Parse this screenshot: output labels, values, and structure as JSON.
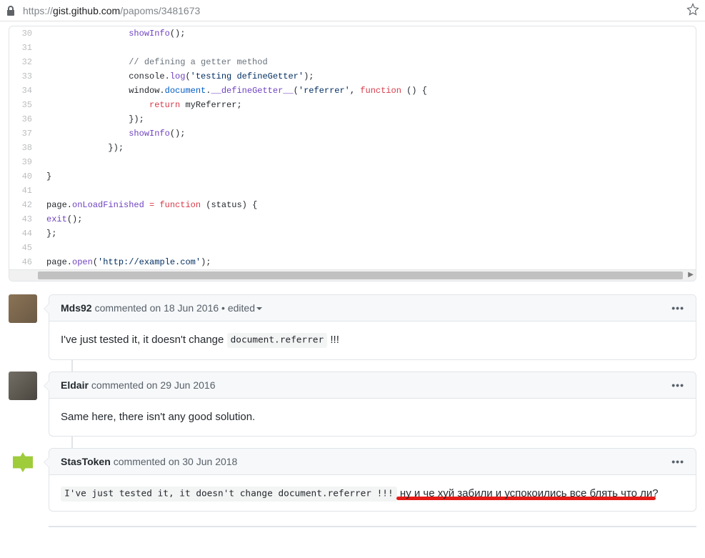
{
  "urlbar": {
    "scheme": "https://",
    "host": "gist.github.com",
    "path": "/papoms/3481673"
  },
  "code": {
    "lines": [
      {
        "n": 30,
        "ind": 16,
        "tokens": [
          {
            "t": "showInfo",
            "c": "pl-en"
          },
          {
            "t": "();"
          }
        ]
      },
      {
        "n": 31,
        "ind": 0,
        "tokens": []
      },
      {
        "n": 32,
        "ind": 16,
        "tokens": [
          {
            "t": "// defining a getter method",
            "c": "pl-c"
          }
        ]
      },
      {
        "n": 33,
        "ind": 16,
        "tokens": [
          {
            "t": "console"
          },
          {
            "t": "."
          },
          {
            "t": "log",
            "c": "pl-en"
          },
          {
            "t": "("
          },
          {
            "t": "'testing defineGetter'",
            "c": "pl-s"
          },
          {
            "t": ");"
          }
        ]
      },
      {
        "n": 34,
        "ind": 16,
        "tokens": [
          {
            "t": "window"
          },
          {
            "t": "."
          },
          {
            "t": "document",
            "c": "pl-smi"
          },
          {
            "t": "."
          },
          {
            "t": "__defineGetter__",
            "c": "pl-en"
          },
          {
            "t": "("
          },
          {
            "t": "'referrer'",
            "c": "pl-s"
          },
          {
            "t": ", "
          },
          {
            "t": "function",
            "c": "pl-k"
          },
          {
            "t": " () {"
          }
        ]
      },
      {
        "n": 35,
        "ind": 20,
        "tokens": [
          {
            "t": "return",
            "c": "pl-k"
          },
          {
            "t": " myReferrer;"
          }
        ]
      },
      {
        "n": 36,
        "ind": 16,
        "tokens": [
          {
            "t": "});"
          }
        ]
      },
      {
        "n": 37,
        "ind": 16,
        "tokens": [
          {
            "t": "showInfo",
            "c": "pl-en"
          },
          {
            "t": "();"
          }
        ]
      },
      {
        "n": 38,
        "ind": 12,
        "tokens": [
          {
            "t": "});"
          }
        ]
      },
      {
        "n": 39,
        "ind": 0,
        "tokens": []
      },
      {
        "n": 40,
        "ind": 0,
        "tokens": [
          {
            "t": "}"
          }
        ]
      },
      {
        "n": 41,
        "ind": 0,
        "tokens": []
      },
      {
        "n": 42,
        "ind": 0,
        "tokens": [
          {
            "t": "page"
          },
          {
            "t": "."
          },
          {
            "t": "onLoadFinished",
            "c": "pl-en"
          },
          {
            "t": " "
          },
          {
            "t": "=",
            "c": "pl-k"
          },
          {
            "t": " "
          },
          {
            "t": "function",
            "c": "pl-k"
          },
          {
            "t": " (status) {"
          }
        ]
      },
      {
        "n": 43,
        "ind": 0,
        "tokens": [
          {
            "t": "exit",
            "c": "pl-en"
          },
          {
            "t": "();"
          }
        ]
      },
      {
        "n": 44,
        "ind": 0,
        "tokens": [
          {
            "t": "};"
          }
        ]
      },
      {
        "n": 45,
        "ind": 0,
        "tokens": []
      },
      {
        "n": 46,
        "ind": 0,
        "tokens": [
          {
            "t": "page"
          },
          {
            "t": "."
          },
          {
            "t": "open",
            "c": "pl-en"
          },
          {
            "t": "("
          },
          {
            "t": "'http://example.com'",
            "c": "pl-s"
          },
          {
            "t": ");"
          }
        ]
      }
    ]
  },
  "comments": [
    {
      "author": "Mds92",
      "verb": "commented",
      "date": "on 18 Jun 2016",
      "edited": " • edited",
      "body_pre": "I've just tested it, it doesn't change ",
      "body_code": "document.referrer",
      "body_post": " !!!"
    },
    {
      "author": "Eldair",
      "verb": "commented",
      "date": "on 29 Jun 2016",
      "body_text": "Same here, there isn't any good solution."
    },
    {
      "author": "StasToken",
      "verb": "commented",
      "date": "on 30 Jun 2018",
      "body_code_full": "I've just tested it, it doesn't change document.referrer !!!",
      "body_tail": " ну и че хуй забили и успокоились все блять что ли?"
    }
  ]
}
